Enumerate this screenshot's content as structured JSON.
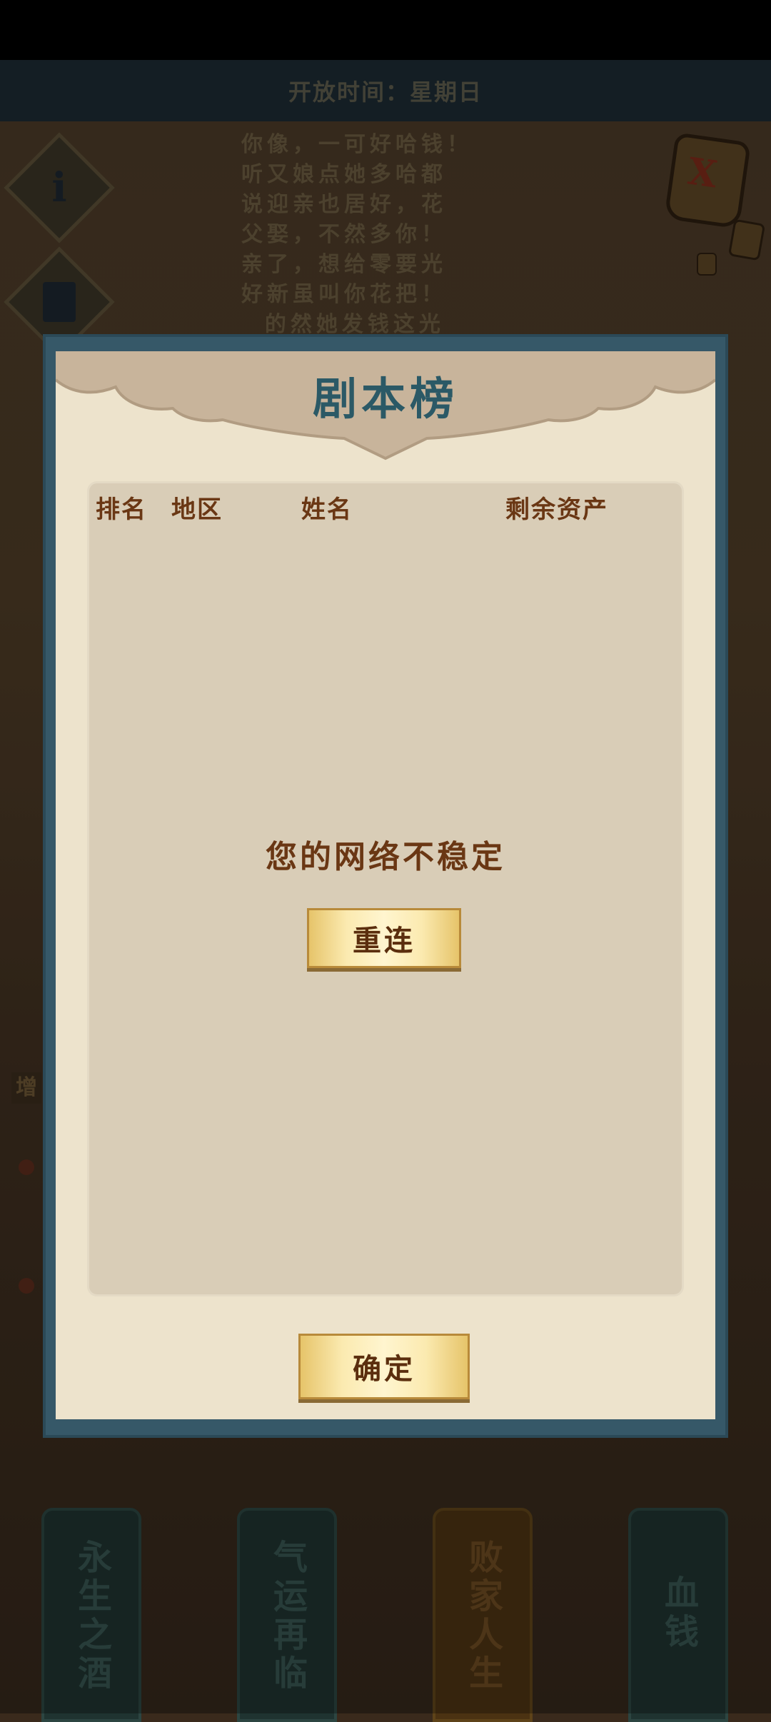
{
  "background": {
    "banner_text": "开放时间：星期日",
    "story_text": "你像，一可好哈钱！\n听又娘点她多哈都\n说迎亲也居好，花\n父娶，不然多你！\n亲了，想给零要光\n好新虽叫你花把！\n  的然她发钱这光",
    "info_icon_glyph": "i",
    "lantern_glyph": "X",
    "side_tag": "增",
    "bottom_cards": [
      {
        "label": "永生之酒"
      },
      {
        "label": "气运再临"
      },
      {
        "label": "败家人生"
      },
      {
        "label": "血钱"
      }
    ]
  },
  "modal": {
    "title": "剧本榜",
    "columns": [
      "排名",
      "地区",
      "姓名",
      "剩余资产"
    ],
    "network_message": "您的网络不稳定",
    "reconnect_label": "重连",
    "confirm_label": "确定"
  },
  "colors": {
    "modal_frame": "#365868",
    "modal_paper": "#ede3cc",
    "title_color": "#2b5966",
    "text_brown": "#6a3714",
    "gold_button": "#fbeab0"
  }
}
